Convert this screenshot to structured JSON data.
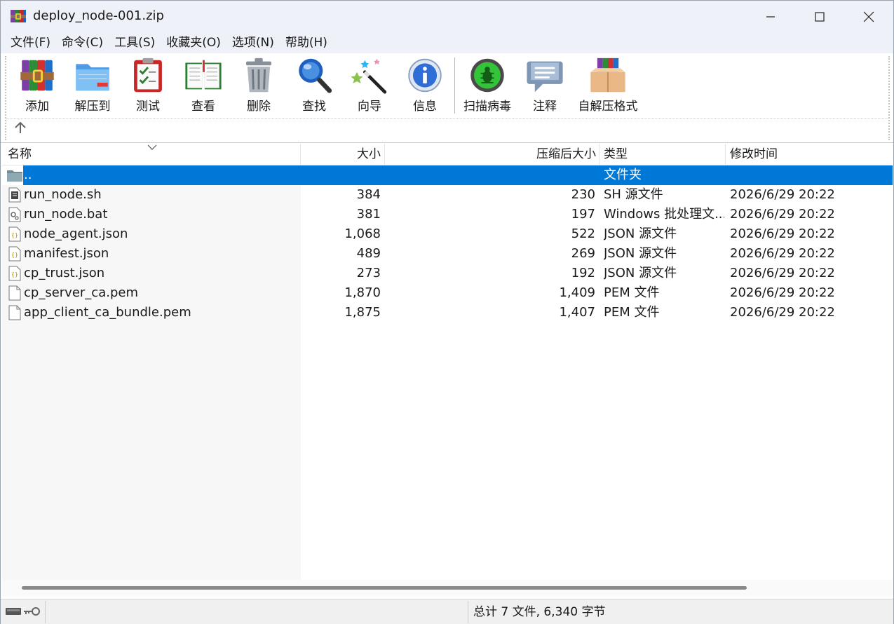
{
  "window": {
    "title": "deploy_node-001.zip",
    "icon": "winrar-books-icon"
  },
  "menu": [
    "文件(F)",
    "命令(C)",
    "工具(S)",
    "收藏夹(O)",
    "选项(N)",
    "帮助(H)"
  ],
  "toolbar": {
    "buttons": [
      {
        "label": "添加",
        "icon": "add-archive-icon"
      },
      {
        "label": "解压到",
        "icon": "extract-folder-icon"
      },
      {
        "label": "测试",
        "icon": "test-clipboard-icon"
      },
      {
        "label": "查看",
        "icon": "view-book-icon"
      },
      {
        "label": "删除",
        "icon": "trash-bin-icon"
      },
      {
        "label": "查找",
        "icon": "magnifier-icon"
      },
      {
        "label": "向导",
        "icon": "wizard-wand-icon"
      },
      {
        "label": "信息",
        "icon": "info-icon"
      },
      {
        "label": "扫描病毒",
        "icon": "virus-scan-icon"
      },
      {
        "label": "注释",
        "icon": "comment-bubble-icon"
      },
      {
        "label": "自解压格式",
        "icon": "sfx-box-icon"
      }
    ]
  },
  "list": {
    "headers": {
      "name": "名称",
      "size": "大小",
      "packed": "压缩后大小",
      "type": "类型",
      "modified": "修改时间"
    },
    "parent_row": {
      "name": "..",
      "type": "文件夹"
    },
    "rows": [
      {
        "name": "run_node.sh",
        "size": "384",
        "packed": "230",
        "type": "SH 源文件",
        "modified": "2026/6/29 20:22",
        "icon": "script-file-icon"
      },
      {
        "name": "run_node.bat",
        "size": "381",
        "packed": "197",
        "type": "Windows 批处理文...",
        "modified": "2026/6/29 20:22",
        "icon": "batch-file-icon"
      },
      {
        "name": "node_agent.json",
        "size": "1,068",
        "packed": "522",
        "type": "JSON 源文件",
        "modified": "2026/6/29 20:22",
        "icon": "json-file-icon"
      },
      {
        "name": "manifest.json",
        "size": "489",
        "packed": "269",
        "type": "JSON 源文件",
        "modified": "2026/6/29 20:22",
        "icon": "json-file-icon"
      },
      {
        "name": "cp_trust.json",
        "size": "273",
        "packed": "192",
        "type": "JSON 源文件",
        "modified": "2026/6/29 20:22",
        "icon": "json-file-icon"
      },
      {
        "name": "cp_server_ca.pem",
        "size": "1,870",
        "packed": "1,409",
        "type": "PEM 文件",
        "modified": "2026/6/29 20:22",
        "icon": "blank-file-icon"
      },
      {
        "name": "app_client_ca_bundle.pem",
        "size": "1,875",
        "packed": "1,407",
        "type": "PEM 文件",
        "modified": "2026/6/29 20:22",
        "icon": "blank-file-icon"
      }
    ]
  },
  "status": {
    "summary": "总计 7 文件, 6,340 字节",
    "icons": [
      "drive-icon",
      "key-icon"
    ]
  },
  "colors": {
    "selection": "#0078d7",
    "titlebar": "#eef2f8"
  }
}
